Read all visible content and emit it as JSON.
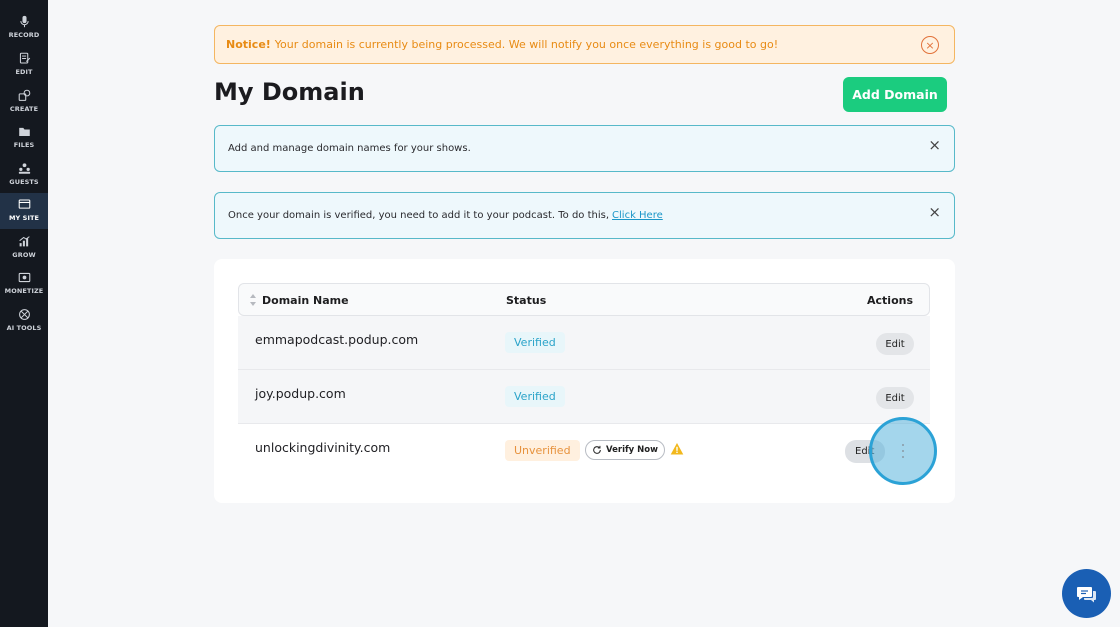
{
  "sidebar": {
    "items": [
      {
        "label": "RECORD",
        "icon": "microphone-icon"
      },
      {
        "label": "EDIT",
        "icon": "edit-document-icon"
      },
      {
        "label": "CREATE",
        "icon": "create-shapes-icon"
      },
      {
        "label": "FILES",
        "icon": "folder-icon"
      },
      {
        "label": "GUESTS",
        "icon": "guests-icon"
      },
      {
        "label": "MY SITE",
        "icon": "website-icon",
        "active": true
      },
      {
        "label": "GROW",
        "icon": "growth-chart-icon"
      },
      {
        "label": "MONETIZE",
        "icon": "monetize-icon"
      },
      {
        "label": "AI TOOLS",
        "icon": "ai-tools-icon"
      }
    ]
  },
  "notice": {
    "prefix": "Notice!",
    "text": "Your domain is currently being processed. We will notify you once everything is good to go!",
    "close_glyph": "×"
  },
  "header": {
    "title": "My Domain",
    "add_button": "Add Domain"
  },
  "info_boxes": {
    "first": {
      "text": "Add and manage domain names for your shows.",
      "close_glyph": "×"
    },
    "second": {
      "text": "Once your domain is verified, you need to add it to your podcast. To do this,",
      "link": "Click Here",
      "close_glyph": "×"
    }
  },
  "table": {
    "columns": {
      "name": "Domain Name",
      "status": "Status",
      "actions": "Actions"
    },
    "rows": [
      {
        "domain": "emmapodcast.podup.com",
        "status": "Verified",
        "action": "Edit"
      },
      {
        "domain": "joy.podup.com",
        "status": "Verified",
        "action": "Edit"
      },
      {
        "domain": "unlockingdivinity.com",
        "status": "Unverified",
        "verify": "Verify Now",
        "action": "Edit"
      }
    ]
  },
  "colors": {
    "sidebar_bg": "#14181f",
    "accent_green": "#1bcc7f",
    "verified": "#2aa3c9",
    "unverified": "#e7923d",
    "notice": "#e88b14",
    "chat": "#1a5fb4"
  }
}
